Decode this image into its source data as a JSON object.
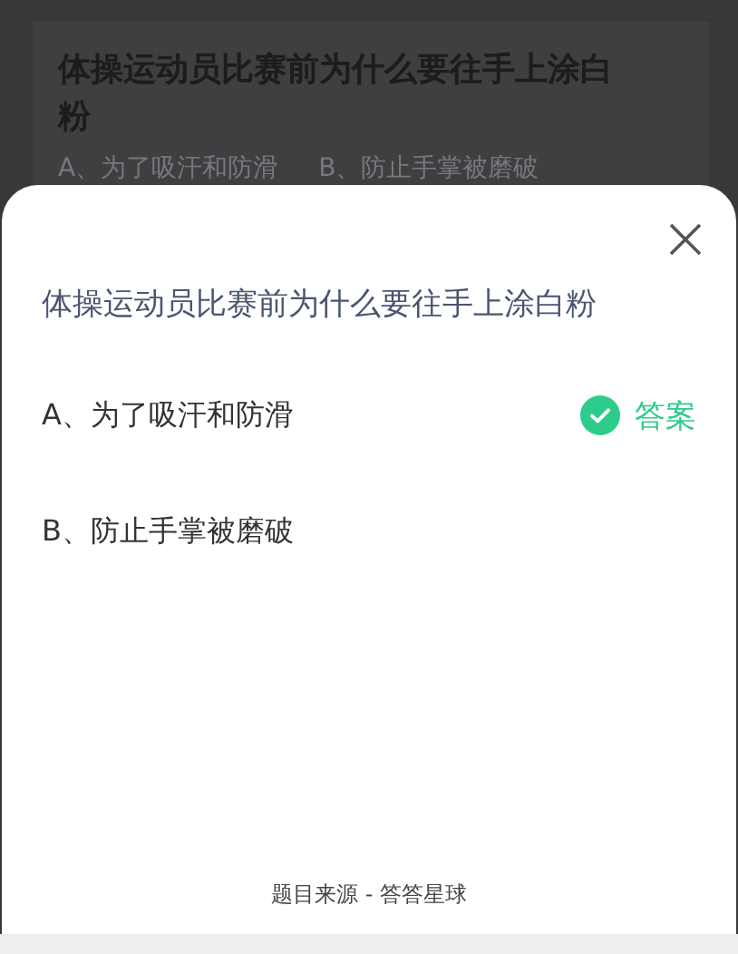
{
  "background_card": {
    "question": "体操运动员比赛前为什么要往手上涂白粉",
    "options": [
      "A、为了吸汗和防滑",
      "B、防止手掌被磨破"
    ]
  },
  "sheet": {
    "question": "体操运动员比赛前为什么要往手上涂白粉",
    "answer_label": "答案",
    "options": [
      {
        "label": "A、为了吸汗和防滑",
        "correct": true
      },
      {
        "label": "B、防止手掌被磨破",
        "correct": false
      }
    ],
    "footer": "题目来源 - 答答星球"
  }
}
